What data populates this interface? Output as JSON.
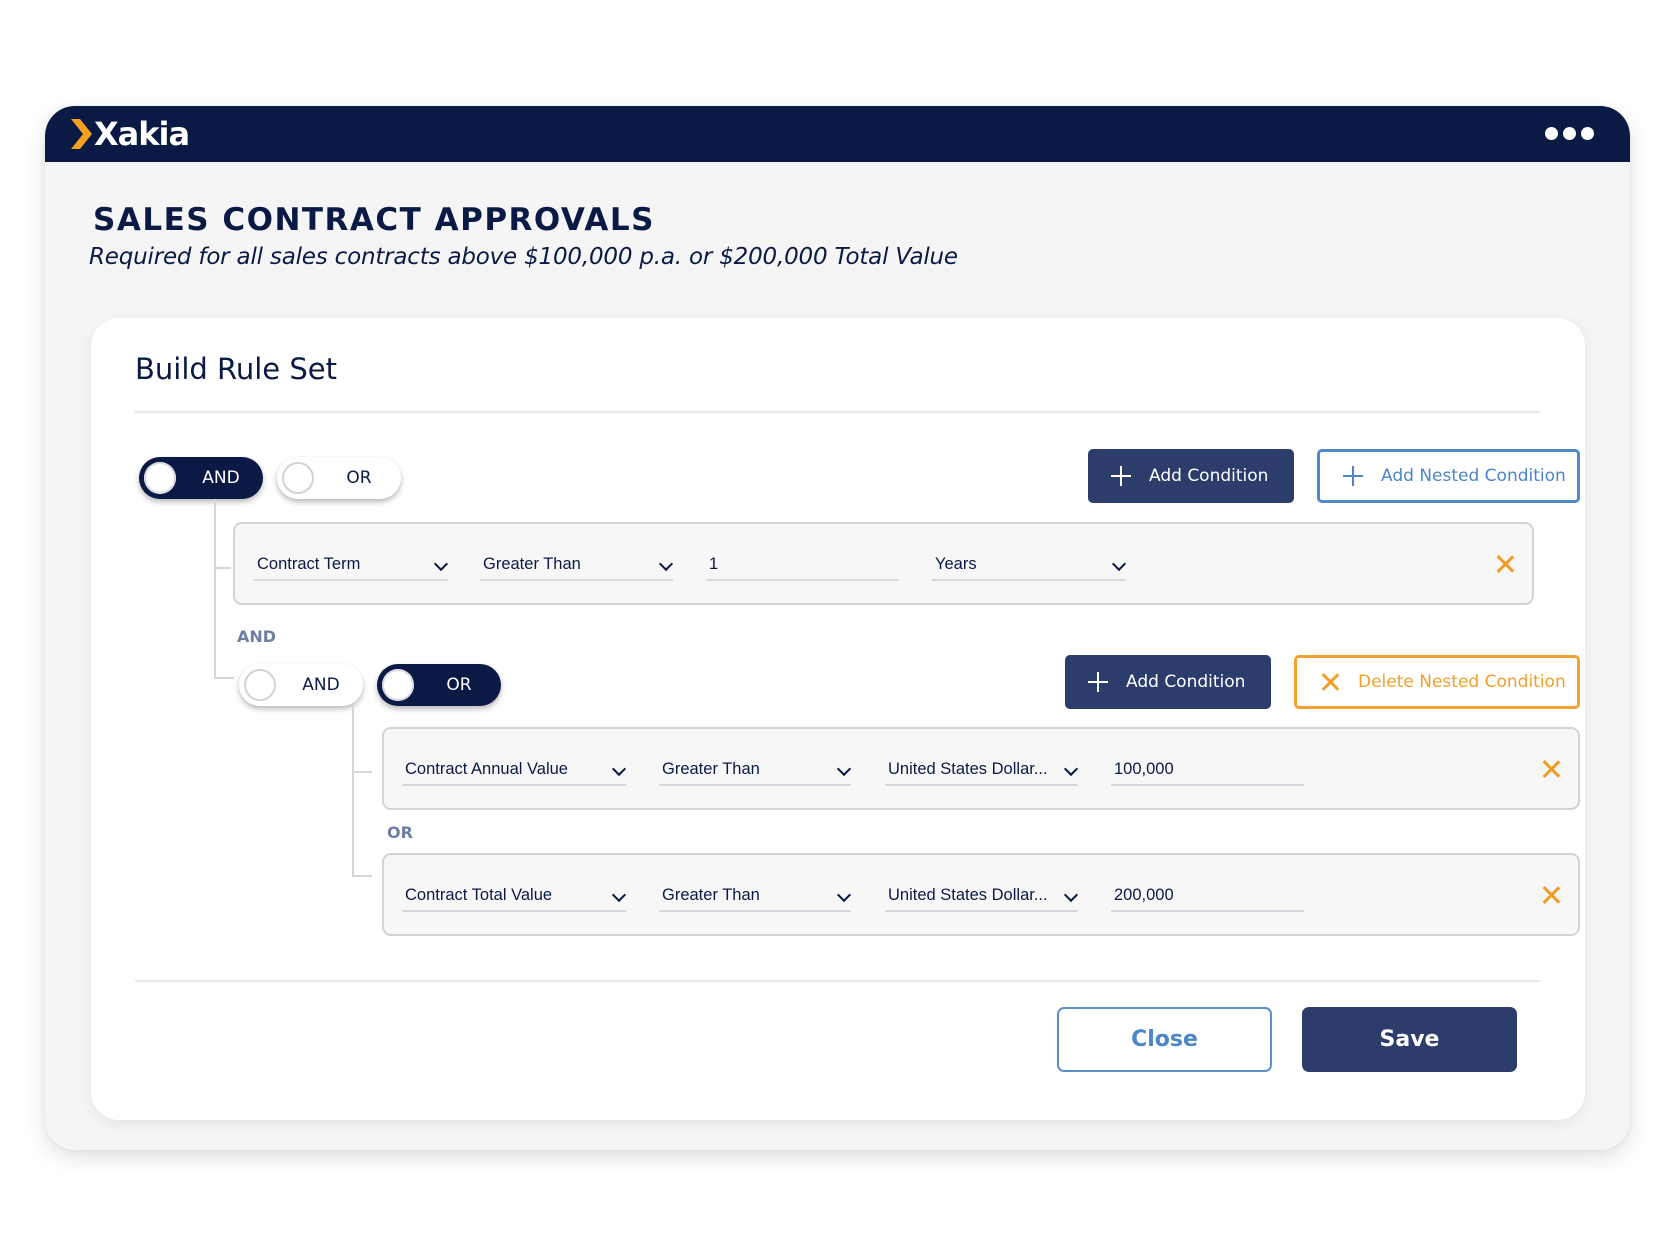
{
  "app": {
    "brand": "Xakia",
    "menu_icon": "more-horizontal-icon"
  },
  "page": {
    "title": "SALES CONTRACT APPROVALS",
    "subtitle": "Required for all sales contracts above $100,000 p.a. or $200,000 Total Value"
  },
  "rule_builder": {
    "title": "Build Rule Set",
    "root_group": {
      "toggles": [
        {
          "label": "AND",
          "selected": true
        },
        {
          "label": "OR",
          "selected": false
        }
      ],
      "add_condition_label": "Add Condition",
      "add_nested_condition_label": "Add Nested Condition",
      "conditions": [
        {
          "field": "Contract Term",
          "operator": "Greater Than",
          "value": "1",
          "unit": "Years"
        }
      ],
      "joiner_label": "AND"
    },
    "nested_group": {
      "toggles": [
        {
          "label": "AND",
          "selected": false
        },
        {
          "label": "OR",
          "selected": true
        }
      ],
      "add_condition_label": "Add Condition",
      "delete_nested_condition_label": "Delete Nested Condition",
      "conditions": [
        {
          "field": "Contract Annual Value",
          "operator": "Greater Than",
          "currency": "United States Dollar...",
          "value": "100,000"
        },
        {
          "field": "Contract Total Value",
          "operator": "Greater Than",
          "currency": "United States Dollar...",
          "value": "200,000"
        }
      ],
      "joiner_label": "OR"
    }
  },
  "footer": {
    "close_label": "Close",
    "save_label": "Save"
  },
  "colors": {
    "navy": "#0a1a45",
    "primary_button": "#2c3d6b",
    "accent_blue": "#4f89c9",
    "accent_orange": "#f3a232",
    "logo_chevron": "#f4a01e"
  }
}
